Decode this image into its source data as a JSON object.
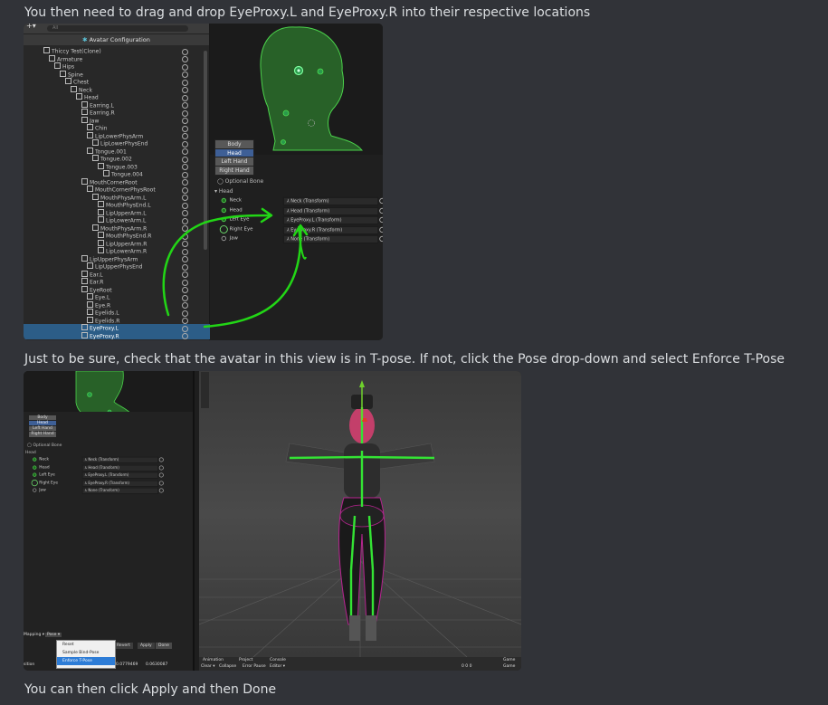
{
  "messages": {
    "m1": "You then need to drag and drop EyeProxy.L and EyeProxy.R into their respective locations",
    "m2": "Just to be sure, check that the avatar in this view is in T-pose. If not, click the Pose drop-down and select Enforce T-Pose",
    "m3": "You can then click Apply and then Done"
  },
  "shot1": {
    "toolbar": {
      "add": "+▾",
      "search": "All"
    },
    "hierarchy_title": "Avatar Configuration",
    "tree": [
      {
        "label": "Thiccy Test(Clone)",
        "depth": 0
      },
      {
        "label": "Armature",
        "depth": 1
      },
      {
        "label": "Hips",
        "depth": 2
      },
      {
        "label": "Spine",
        "depth": 3
      },
      {
        "label": "Chest",
        "depth": 4
      },
      {
        "label": "Neck",
        "depth": 5
      },
      {
        "label": "Head",
        "depth": 6
      },
      {
        "label": "Earring.L",
        "depth": 7
      },
      {
        "label": "Earring.R",
        "depth": 7
      },
      {
        "label": "Jaw",
        "depth": 7
      },
      {
        "label": "Chin",
        "depth": 8
      },
      {
        "label": "LipLowerPhysArm",
        "depth": 8
      },
      {
        "label": "LipLowerPhysEnd",
        "depth": 9
      },
      {
        "label": "Tongue.001",
        "depth": 8
      },
      {
        "label": "Tongue.002",
        "depth": 9
      },
      {
        "label": "Tongue.003",
        "depth": 10
      },
      {
        "label": "Tongue.004",
        "depth": 11
      },
      {
        "label": "MouthCornerRoot",
        "depth": 7
      },
      {
        "label": "MouthCornerPhysRoot",
        "depth": 8
      },
      {
        "label": "MouthPhysArm.L",
        "depth": 9
      },
      {
        "label": "MouthPhysEnd.L",
        "depth": 10
      },
      {
        "label": "LipUpperArm.L",
        "depth": 10
      },
      {
        "label": "LipLowerArm.L",
        "depth": 10
      },
      {
        "label": "MouthPhysArm.R",
        "depth": 9
      },
      {
        "label": "MouthPhysEnd.R",
        "depth": 10
      },
      {
        "label": "LipUpperArm.R",
        "depth": 10
      },
      {
        "label": "LipLowerArm.R",
        "depth": 10
      },
      {
        "label": "LipUpperPhysArm",
        "depth": 7
      },
      {
        "label": "LipUpperPhysEnd",
        "depth": 8
      },
      {
        "label": "Ear.L",
        "depth": 7
      },
      {
        "label": "Ear.R",
        "depth": 7
      },
      {
        "label": "EyeRoot",
        "depth": 7
      },
      {
        "label": "Eye.L",
        "depth": 8
      },
      {
        "label": "Eye.R",
        "depth": 8
      },
      {
        "label": "Eyelids.L",
        "depth": 8
      },
      {
        "label": "Eyelids.R",
        "depth": 8
      },
      {
        "label": "EyeProxy.L",
        "depth": 7,
        "selected": true
      },
      {
        "label": "EyeProxy.R",
        "depth": 7,
        "selected": true
      }
    ],
    "body_buttons": [
      "Body",
      "Head",
      "Left Hand",
      "Right Hand"
    ],
    "optional_bone": "Optional Bone",
    "group": "Head",
    "bones": [
      {
        "label": "Neck",
        "value": "Neck (Transform)",
        "state": "filled"
      },
      {
        "label": "Head",
        "value": "Head (Transform)",
        "state": "filled"
      },
      {
        "label": "Left Eye",
        "value": "EyeProxy.L (Transform)",
        "state": "filled"
      },
      {
        "label": "Right Eye",
        "value": "EyeProxy.R (Transform)",
        "state": "big"
      },
      {
        "label": "Jaw",
        "value": "None (Transform)",
        "state": "empty"
      }
    ]
  },
  "shot2": {
    "body_buttons": [
      "Body",
      "Head",
      "Left Hand",
      "Right Hand"
    ],
    "optional_bone": "Optional Bone",
    "group": "Head",
    "bones": [
      {
        "label": "Neck",
        "value": "Neck (Transform)",
        "state": "filled"
      },
      {
        "label": "Head",
        "value": "Head (Transform)",
        "state": "filled"
      },
      {
        "label": "Left Eye",
        "value": "EyeProxy.L (Transform)",
        "state": "filled"
      },
      {
        "label": "Right Eye",
        "value": "EyeProxy.R (Transform)",
        "state": "big"
      },
      {
        "label": "Jaw",
        "value": "None (Transform)",
        "state": "empty"
      }
    ],
    "mapping_label": "Mapping ▾",
    "pose_label": "Pose ▾",
    "pose_menu": [
      "Reset",
      "Sample Bind-Pose",
      "Enforce T-Pose"
    ],
    "revert": "Revert",
    "apply": "Apply",
    "done": "Done",
    "transform_label": "sition",
    "transform_value": "0.0779469",
    "transform_value2": "0.0630087",
    "tabs": [
      "Animation",
      "Project",
      "Console"
    ],
    "console_bar": [
      "Clear ▾",
      "Collapse",
      "Error Pause",
      "Editor ▾"
    ],
    "game_tab": "Game",
    "game_sel": "Game",
    "counts": "0  0  0"
  }
}
